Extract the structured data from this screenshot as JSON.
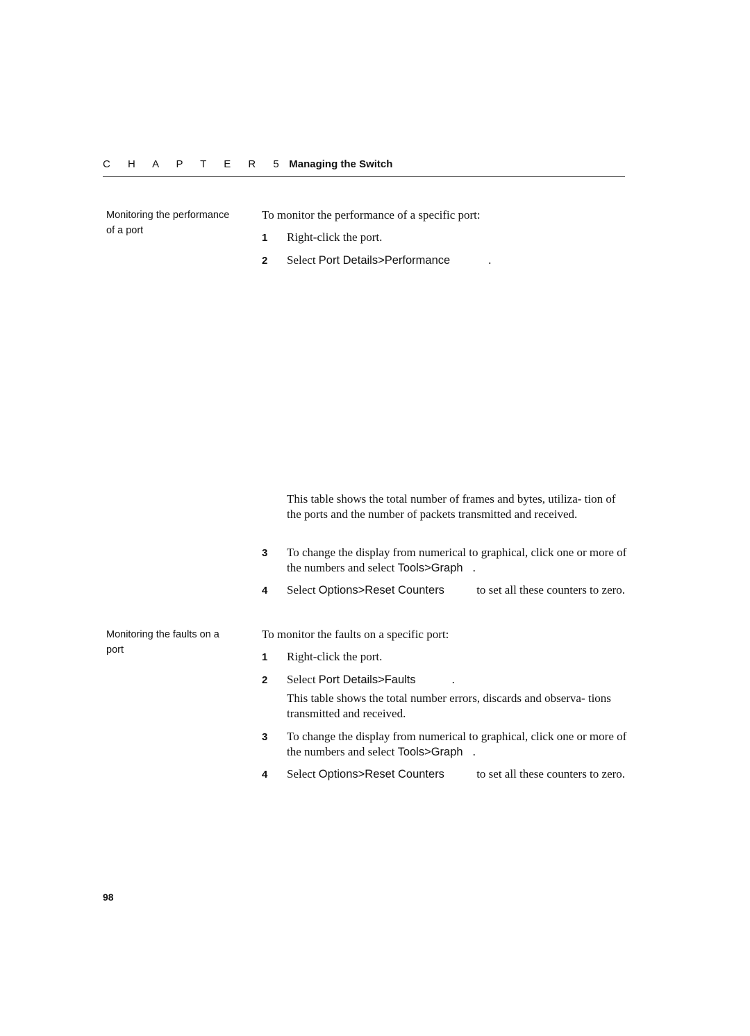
{
  "header": {
    "chapter": "C H A P T E R 5",
    "title": "Managing the Switch"
  },
  "sec1": {
    "side": "Monitoring the performance of a port",
    "intro": "To monitor the performance of a specific port:",
    "steps": [
      {
        "n": "1",
        "text": "Right-click the port."
      },
      {
        "n": "2",
        "pre": "Select ",
        "ui": "Port Details>Performance",
        "post": "."
      }
    ],
    "para": "This table shows the total number of frames and bytes, utiliza- tion of the ports and the number of packets transmitted and received.",
    "step3": {
      "n": "3",
      "pre": "To change the display from numerical to graphical, click one or more of the numbers and select ",
      "ui": "Tools>Graph",
      "post": "."
    },
    "step4": {
      "n": "4",
      "pre": "Select ",
      "ui": "Options>Reset Counters",
      "post": " to set all these counters to zero."
    }
  },
  "sec2": {
    "side": "Monitoring the faults on a port",
    "intro": "To monitor the faults on a specific port:",
    "steps": [
      {
        "n": "1",
        "text": "Right-click the port."
      },
      {
        "n": "2",
        "pre": "Select ",
        "ui": "Port Details>Faults",
        "post": "."
      }
    ],
    "para": "This table shows the total number errors, discards and observa- tions transmitted and received.",
    "step3": {
      "n": "3",
      "pre": "To change the display from numerical to graphical, click one or more of the numbers and select ",
      "ui": "Tools>Graph",
      "post": "."
    },
    "step4": {
      "n": "4",
      "pre": "Select ",
      "ui": "Options>Reset Counters",
      "post": " to set all these counters to zero."
    }
  },
  "page_number": "98"
}
